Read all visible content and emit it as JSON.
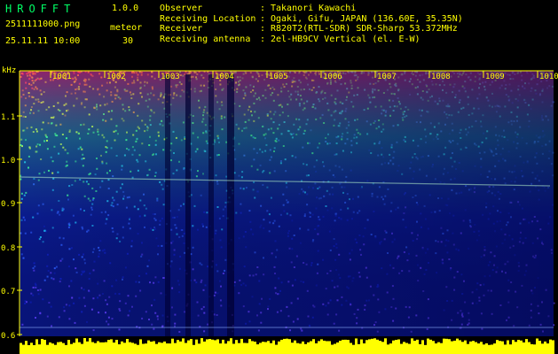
{
  "header": {
    "app_title": "HROFFT",
    "version": "1.0.0",
    "filename": "2511111000.png",
    "meteor_label": "meteor",
    "datetime": "25.11.11 10:00",
    "meteor_count": "30"
  },
  "meta": [
    {
      "label": "Observer",
      "value": "Takanori Kawachi"
    },
    {
      "label": "Receiving Location",
      "value": "Ogaki, Gifu, JAPAN (136.60E, 35.35N)"
    },
    {
      "label": "Receiver",
      "value": "R820T2(RTL-SDR) SDR-Sharp 53.372MHz"
    },
    {
      "label": "Receiving antenna",
      "value": "2el-HB9CV Vertical (el. E-W)"
    }
  ],
  "plot": {
    "y_unit": "kHz",
    "y_ticks": [
      "1.1",
      "1.0",
      "0.9",
      "0.8",
      "0.7",
      "0.6"
    ],
    "x_ticks": [
      "1001",
      "1002",
      "1003",
      "1004",
      "1005",
      "1006",
      "1007",
      "1008",
      "1009",
      "1010"
    ],
    "colors": {
      "axis": "#ffff00",
      "signal": "#ffff00",
      "background_noise": "#0a1ea0"
    }
  }
}
